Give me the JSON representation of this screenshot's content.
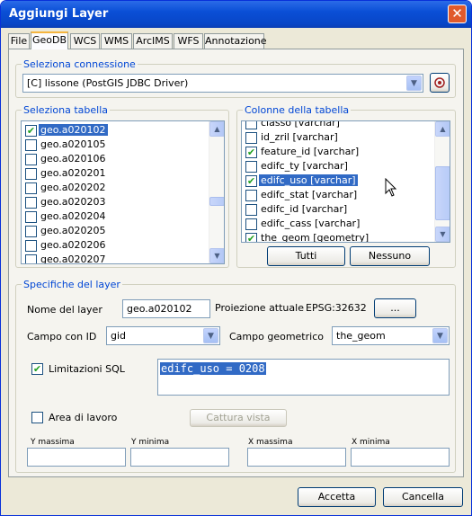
{
  "window": {
    "title": "Aggiungi Layer",
    "close_glyph": "✕"
  },
  "tabs": [
    {
      "label": "File",
      "active": false
    },
    {
      "label": "GeoDB",
      "active": true
    },
    {
      "label": "WCS",
      "active": false
    },
    {
      "label": "WMS",
      "active": false
    },
    {
      "label": "ArcIMS",
      "active": false
    },
    {
      "label": "WFS",
      "active": false
    },
    {
      "label": "Annotazione",
      "active": false
    }
  ],
  "connection": {
    "legend": "Seleziona connessione",
    "value": "[C] lissone (PostGIS JDBC Driver)"
  },
  "tables": {
    "legend": "Seleziona tabella",
    "items": [
      {
        "label": "geo.a020102",
        "checked": true,
        "selected": true
      },
      {
        "label": "geo.a020105",
        "checked": false
      },
      {
        "label": "geo.a020106",
        "checked": false
      },
      {
        "label": "geo.a020201",
        "checked": false
      },
      {
        "label": "geo.a020202",
        "checked": false
      },
      {
        "label": "geo.a020203",
        "checked": false
      },
      {
        "label": "geo.a020204",
        "checked": false
      },
      {
        "label": "geo.a020205",
        "checked": false
      },
      {
        "label": "geo.a020206",
        "checked": false
      },
      {
        "label": "geo.a020207",
        "checked": false
      }
    ]
  },
  "columns": {
    "legend": "Colonne della tabella",
    "items": [
      {
        "label": "classo [varchar]",
        "checked": false
      },
      {
        "label": "id_zril [varchar]",
        "checked": false
      },
      {
        "label": "feature_id [varchar]",
        "checked": true
      },
      {
        "label": "edifc_ty [varchar]",
        "checked": false
      },
      {
        "label": "edifc_uso [varchar]",
        "checked": true,
        "selected": true
      },
      {
        "label": "edifc_stat [varchar]",
        "checked": false
      },
      {
        "label": "edifc_id [varchar]",
        "checked": false
      },
      {
        "label": "edifc_cass [varchar]",
        "checked": false
      },
      {
        "label": "the_geom [geometry]",
        "checked": true
      }
    ],
    "all_button": "Tutti",
    "none_button": "Nessuno"
  },
  "layer": {
    "legend": "Specifiche del layer",
    "name_label": "Nome del layer",
    "name_value": "geo.a020102",
    "projection_label": "Proiezione attuale",
    "projection_value": "EPSG:32632",
    "projection_button": "...",
    "id_field_label": "Campo con ID",
    "id_field_value": "gid",
    "geom_field_label": "Campo geometrico",
    "geom_field_value": "the_geom",
    "sql_label": "Limitazioni SQL",
    "sql_checked": true,
    "sql_value": "edifc_uso = 0208",
    "workarea_label": "Area di lavoro",
    "workarea_checked": false,
    "capture_button": "Cattura vista",
    "ymax_label": "Y massima",
    "ymin_label": "Y minima",
    "xmax_label": "X massima",
    "xmin_label": "X minima"
  },
  "footer": {
    "accept": "Accetta",
    "cancel": "Cancella"
  },
  "checkmark": "✔"
}
